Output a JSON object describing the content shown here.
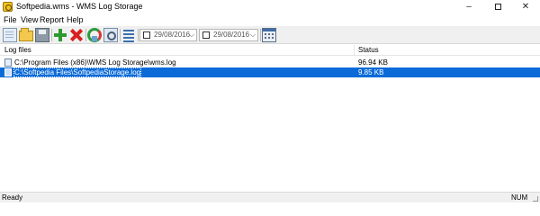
{
  "window": {
    "title": "Softpedia.wms - WMS Log Storage",
    "icon": "app-icon",
    "controls": {
      "minimize": "–",
      "close": "✕"
    }
  },
  "menu": {
    "items": [
      "File",
      "View",
      "Report",
      "Help"
    ]
  },
  "toolbar": {
    "buttons": [
      "new-icon",
      "open-folder-icon",
      "save-icon",
      "add-icon",
      "delete-icon",
      "recycle-icon",
      "find-icon",
      "list-icon",
      "calendar-icon"
    ],
    "date_from": "29/08/2016",
    "date_to": "29/08/2016",
    "dropdown_arrow": "⌵"
  },
  "list": {
    "columns": {
      "file": "Log files",
      "status": "Status"
    },
    "rows": [
      {
        "file": "C:\\Program Files (x86)\\WMS Log Storage\\wms.log",
        "status": "96.94 KB",
        "selected": false
      },
      {
        "file": "C:\\Softpedia Files\\SoftpediaStorage.log",
        "status": "9.85 KB",
        "selected": true
      }
    ],
    "selection_color": "#0a6ad8"
  },
  "statusbar": {
    "left": "Ready",
    "right": "NUM"
  }
}
